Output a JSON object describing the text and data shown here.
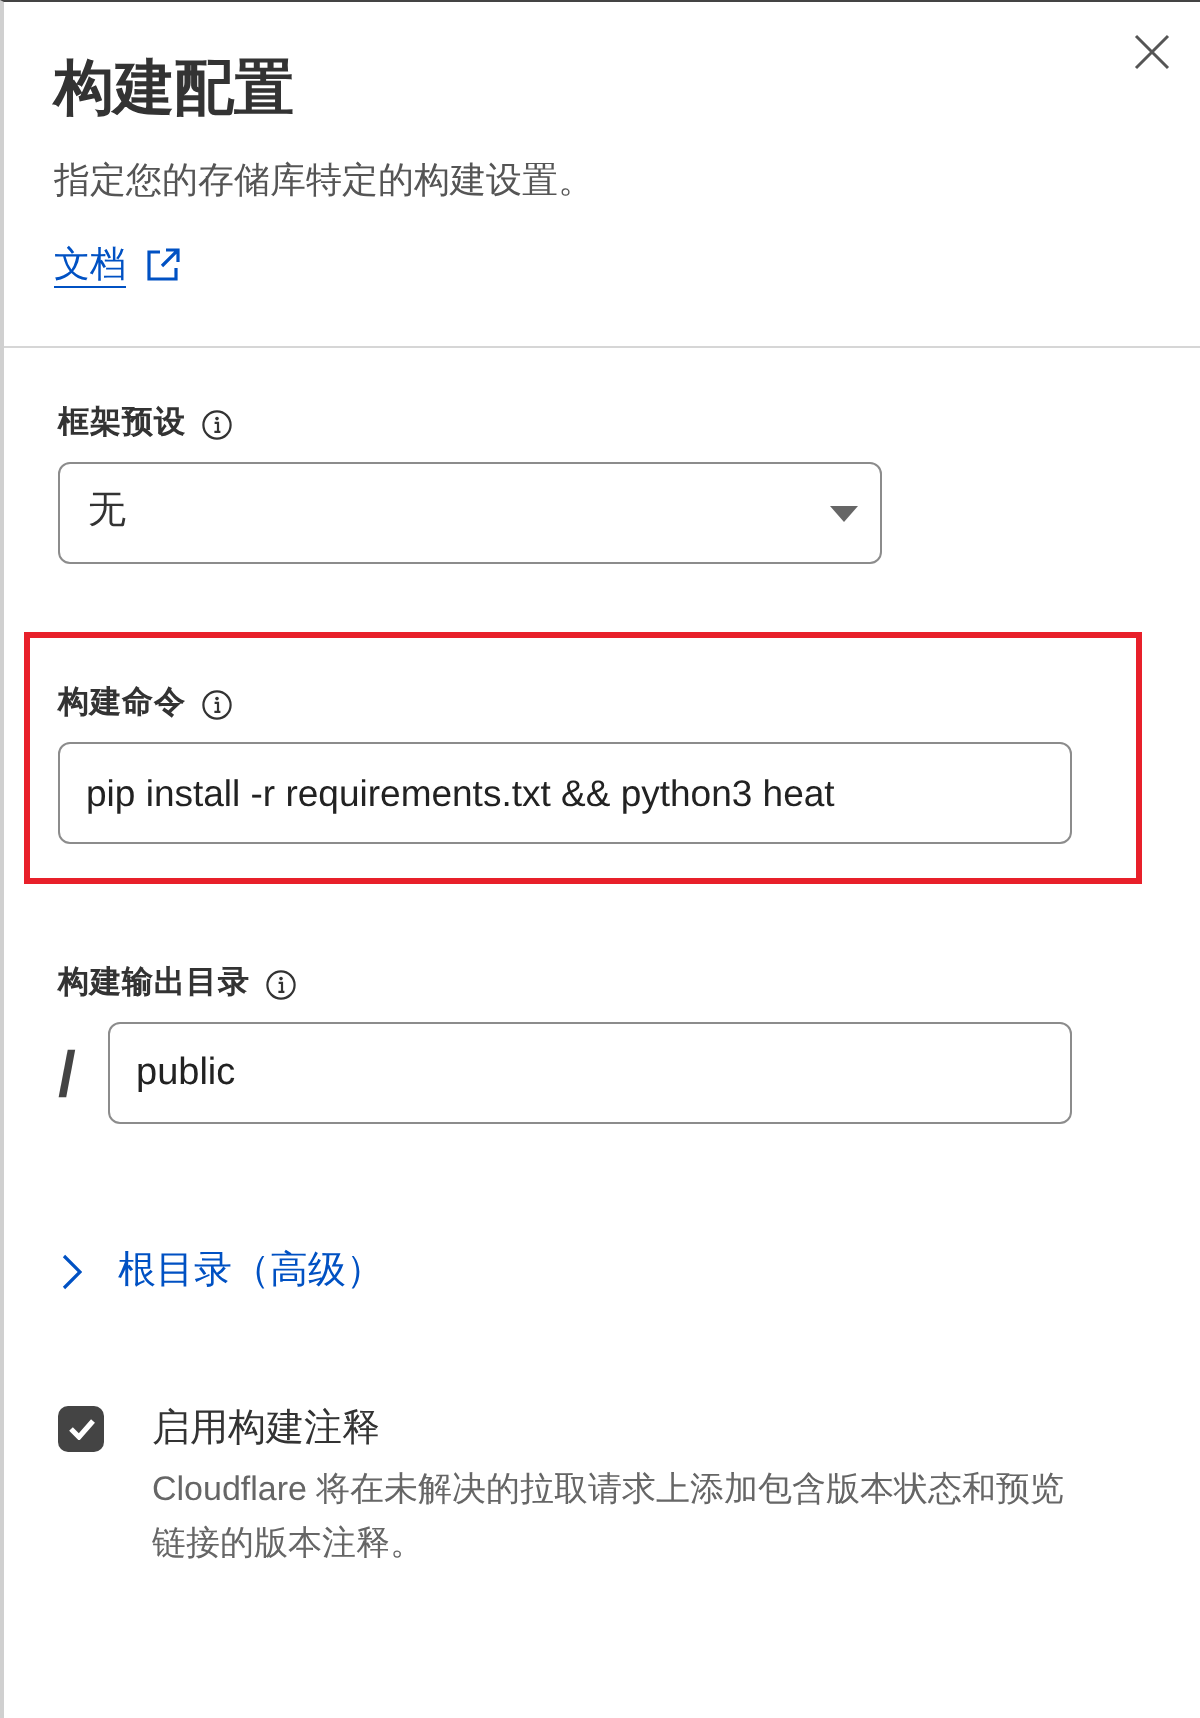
{
  "panel": {
    "title": "构建配置",
    "description": "指定您的存储库特定的构建设置。",
    "docs_link": "文档"
  },
  "fields": [
    {
      "kind": "select",
      "label": "框架预设",
      "value": "无",
      "highlighted": false
    },
    {
      "kind": "text",
      "label": "构建命令",
      "value": "pip install -r requirements.txt && python3 heat",
      "highlighted": true
    },
    {
      "kind": "path",
      "label": "构建输出目录",
      "prefix": "/",
      "value": "public",
      "highlighted": false
    }
  ],
  "root_directory": {
    "label": "根目录（高级）",
    "expanded": false
  },
  "build_comments": {
    "label": "启用构建注释",
    "checked": true,
    "description": "Cloudflare 将在未解决的拉取请求上添加包含版本状态和预览链接的版本注释。"
  }
}
